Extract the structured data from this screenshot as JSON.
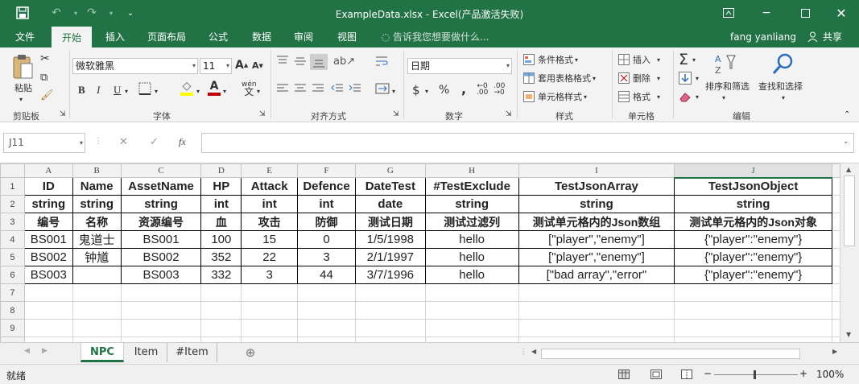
{
  "window": {
    "title": "ExampleData.xlsx - Excel(产品激活失败)"
  },
  "menu": {
    "tabs": [
      "文件",
      "开始",
      "插入",
      "页面布局",
      "公式",
      "数据",
      "审阅",
      "视图"
    ],
    "tell_me": "告诉我您想要做什么...",
    "user": "fang yanliang",
    "share": "共享"
  },
  "ribbon": {
    "clipboard": {
      "paste": "粘贴",
      "label": "剪贴板"
    },
    "font": {
      "name": "微软雅黑",
      "size": "11",
      "label": "字体",
      "bold": "B",
      "italic": "I",
      "underline": "U",
      "grow": "A",
      "shrink": "A",
      "wen": "wén",
      "color_a": "A"
    },
    "align": {
      "label": "对齐方式"
    },
    "number": {
      "format": "日期",
      "label": "数字",
      "currency": "$",
      "percent": "%",
      "comma": ","
    },
    "styles": {
      "cond": "条件格式",
      "table": "套用表格格式",
      "cell": "单元格样式",
      "label": "样式"
    },
    "cells": {
      "insert": "插入",
      "delete": "删除",
      "format": "格式",
      "label": "单元格"
    },
    "editing": {
      "sort": "排序和筛选",
      "find": "查找和选择",
      "label": "编辑",
      "sigma": "Σ"
    }
  },
  "formula_bar": {
    "name_box": "J11",
    "fx": "fx",
    "content": ""
  },
  "sheet": {
    "columns": [
      "A",
      "B",
      "C",
      "D",
      "E",
      "F",
      "G",
      "H",
      "I",
      "J"
    ],
    "rows": [
      {
        "n": "1",
        "cells": [
          "ID",
          "Name",
          "AssetName",
          "HP",
          "Attack",
          "Defence",
          "DateTest",
          "#TestExclude",
          "TestJsonArray",
          "TestJsonObject"
        ]
      },
      {
        "n": "2",
        "cells": [
          "string",
          "string",
          "string",
          "int",
          "int",
          "int",
          "date",
          "string",
          "string",
          "string"
        ]
      },
      {
        "n": "3",
        "cells": [
          "编号",
          "名称",
          "资源编号",
          "血",
          "攻击",
          "防御",
          "测试日期",
          "测试过滤列",
          "测试单元格内的Json数组",
          "测试单元格内的Json对象"
        ]
      },
      {
        "n": "4",
        "cells": [
          "BS001",
          "鬼道士",
          "BS001",
          "100",
          "15",
          "0",
          "1/5/1998",
          "hello",
          "[\"player\",\"enemy\"]",
          "{\"player\":\"enemy\"}"
        ]
      },
      {
        "n": "5",
        "cells": [
          "BS002",
          "钟馗",
          "BS002",
          "352",
          "22",
          "3",
          "2/1/1997",
          "hello",
          "[\"player\",\"enemy\"]",
          "{\"player\":\"enemy\"}"
        ]
      },
      {
        "n": "6",
        "cells": [
          "BS003",
          "",
          "BS003",
          "332",
          "3",
          "44",
          "3/7/1996",
          "hello",
          "[\"bad array\",\"error\"",
          "{\"player\":\"enemy\"}"
        ]
      },
      {
        "n": "7",
        "cells": [
          "",
          "",
          "",
          "",
          "",
          "",
          "",
          "",
          "",
          ""
        ]
      },
      {
        "n": "8",
        "cells": [
          "",
          "",
          "",
          "",
          "",
          "",
          "",
          "",
          "",
          ""
        ]
      },
      {
        "n": "9",
        "cells": [
          "",
          "",
          "",
          "",
          "",
          "",
          "",
          "",
          "",
          ""
        ]
      },
      {
        "n": "10",
        "cells": [
          "",
          "",
          "",
          "",
          "",
          "",
          "",
          "",
          "",
          ""
        ]
      }
    ]
  },
  "tabs": {
    "sheets": [
      "NPC",
      "Item",
      "#Item"
    ],
    "active": "NPC",
    "add": "⊕"
  },
  "status": {
    "ready": "就绪",
    "zoom": "100%",
    "minus": "−",
    "plus": "+"
  },
  "colors": {
    "brand": "#217346",
    "accent_red": "#c00000",
    "highlight_yellow": "#ffff00"
  }
}
